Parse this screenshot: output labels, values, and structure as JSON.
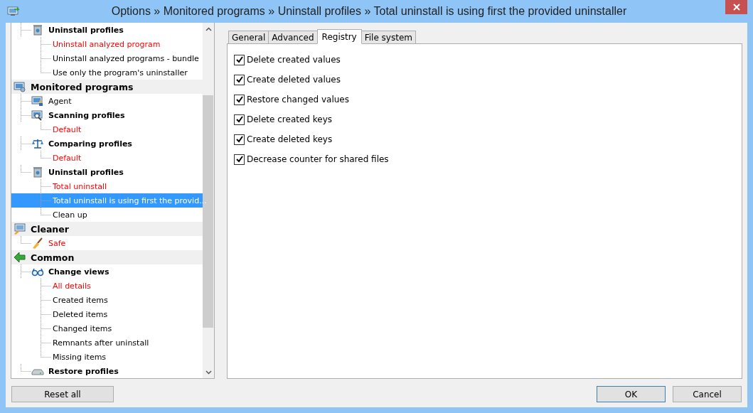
{
  "window": {
    "title": "Options » Monitored programs » Uninstall profiles » Total uninstall is using first the provided uninstaller"
  },
  "tree": {
    "items": [
      {
        "label": "Uninstall profiles",
        "kind": "group",
        "color": "#000000",
        "selected": false,
        "children": [
          {
            "label": "Uninstall analyzed program",
            "kind": "leaf",
            "color": "#ff0000",
            "selected": false
          },
          {
            "label": "Uninstall analyzed programs - bundle",
            "kind": "leaf",
            "color": "#000000",
            "selected": false
          },
          {
            "label": "Use only the program's uninstaller",
            "kind": "leaf",
            "color": "#000000",
            "selected": false
          }
        ]
      },
      {
        "label": "Monitored programs",
        "kind": "section",
        "color": "#000000",
        "selected": false,
        "children": [
          {
            "label": "Agent",
            "kind": "item",
            "color": "#000000",
            "selected": false
          },
          {
            "label": "Scanning profiles",
            "kind": "group",
            "color": "#000000",
            "selected": false,
            "children": [
              {
                "label": "Default",
                "kind": "leaf",
                "color": "#ff0000",
                "selected": false
              }
            ]
          },
          {
            "label": "Comparing profiles",
            "kind": "group",
            "color": "#000000",
            "selected": false,
            "children": [
              {
                "label": "Default",
                "kind": "leaf",
                "color": "#ff0000",
                "selected": false
              }
            ]
          },
          {
            "label": "Uninstall profiles",
            "kind": "group",
            "color": "#000000",
            "selected": false,
            "children": [
              {
                "label": "Total uninstall",
                "kind": "leaf",
                "color": "#ff0000",
                "selected": false
              },
              {
                "label": "Total uninstall is using first the provid...",
                "kind": "leaf",
                "color": "#ffffff",
                "selected": true
              },
              {
                "label": "Clean up",
                "kind": "leaf",
                "color": "#000000",
                "selected": false
              }
            ]
          }
        ]
      },
      {
        "label": "Cleaner",
        "kind": "section",
        "color": "#000000",
        "selected": false,
        "children": [
          {
            "label": "Safe",
            "kind": "item",
            "color": "#ff0000",
            "selected": false
          }
        ]
      },
      {
        "label": "Common",
        "kind": "section",
        "color": "#000000",
        "selected": false,
        "children": [
          {
            "label": "Change views",
            "kind": "group",
            "color": "#000000",
            "selected": false,
            "children": [
              {
                "label": "All details",
                "kind": "leaf",
                "color": "#ff0000",
                "selected": false
              },
              {
                "label": "Created items",
                "kind": "leaf",
                "color": "#000000",
                "selected": false
              },
              {
                "label": "Deleted items",
                "kind": "leaf",
                "color": "#000000",
                "selected": false
              },
              {
                "label": "Changed items",
                "kind": "leaf",
                "color": "#000000",
                "selected": false
              },
              {
                "label": "Remnants after uninstall",
                "kind": "leaf",
                "color": "#000000",
                "selected": false
              },
              {
                "label": "Missing items",
                "kind": "leaf",
                "color": "#000000",
                "selected": false
              }
            ]
          },
          {
            "label": "Restore profiles",
            "kind": "group",
            "color": "#000000",
            "selected": false
          }
        ]
      }
    ]
  },
  "tabs": [
    {
      "label": "General",
      "selected": false
    },
    {
      "label": "Advanced",
      "selected": false
    },
    {
      "label": "Registry",
      "selected": true
    },
    {
      "label": "File system",
      "selected": false
    }
  ],
  "options": [
    {
      "label": "Delete created values",
      "checked": true
    },
    {
      "label": "Create deleted values",
      "checked": true
    },
    {
      "label": "Restore changed values",
      "checked": true
    },
    {
      "label": "Delete created keys",
      "checked": true
    },
    {
      "label": "Create deleted keys",
      "checked": true
    },
    {
      "label": "Decrease counter for shared files",
      "checked": true
    }
  ],
  "buttons": {
    "left": [
      "Reset all"
    ],
    "right": [
      "OK",
      "Cancel"
    ]
  }
}
